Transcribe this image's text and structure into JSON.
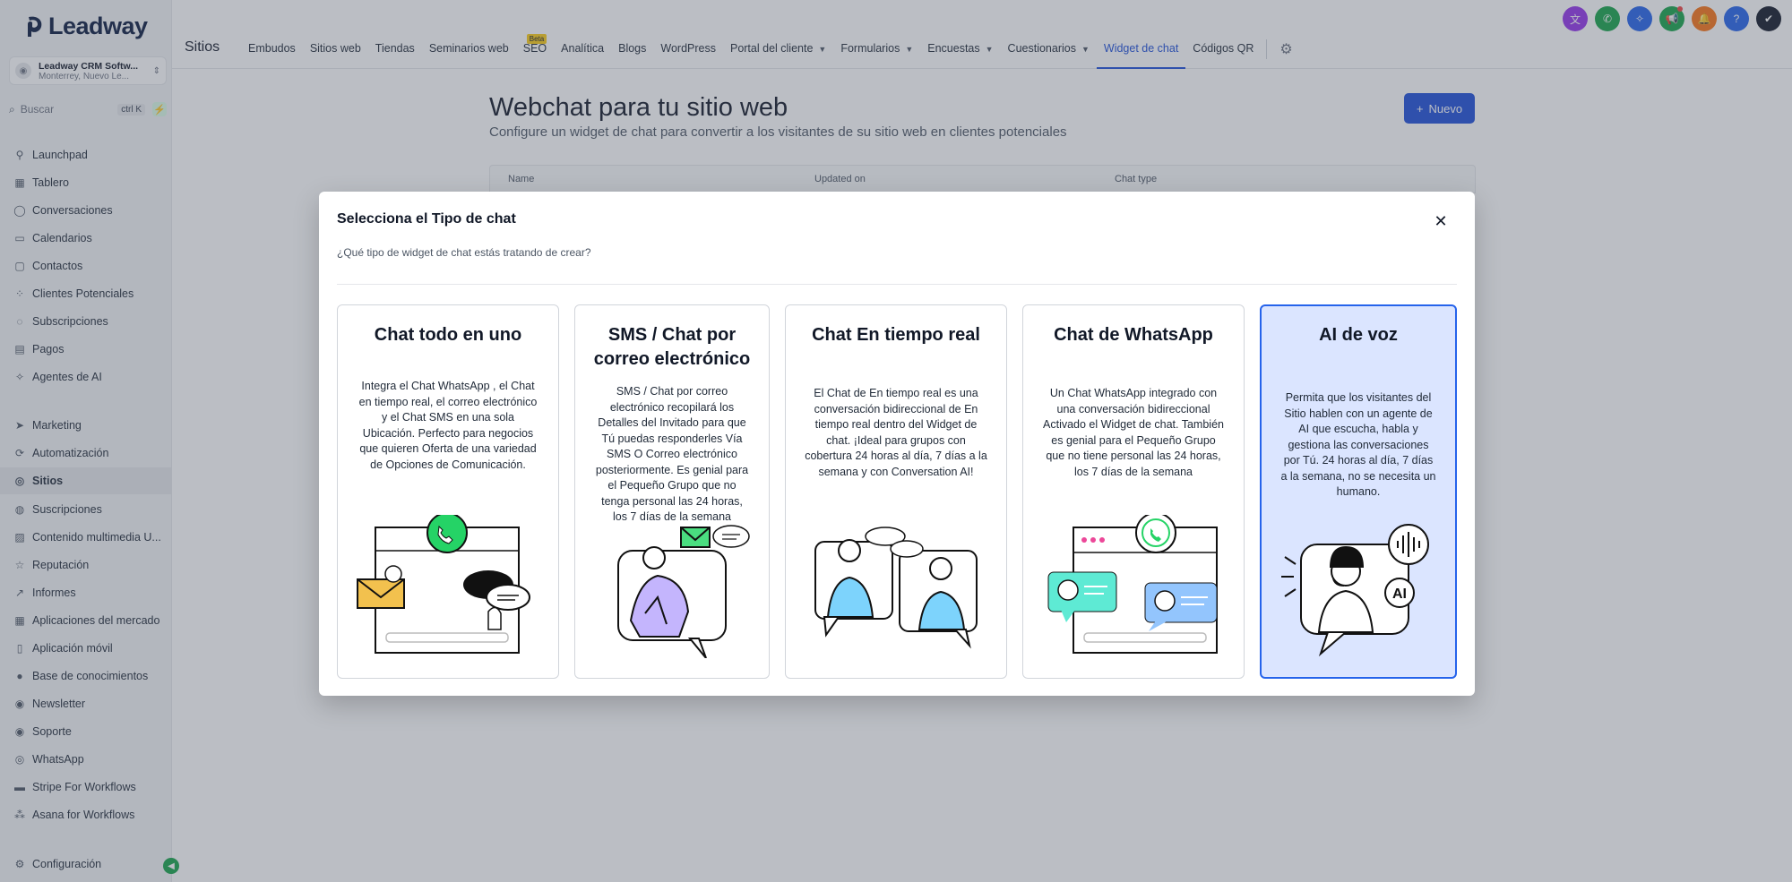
{
  "app": {
    "brand": "Leadway"
  },
  "location": {
    "name": "Leadway CRM Softw...",
    "sub": "Monterrey, Nuevo Le..."
  },
  "search": {
    "label": "Buscar",
    "shortcut": "ctrl K"
  },
  "sidebar": {
    "items": [
      {
        "label": "Launchpad",
        "icon": "rocket-icon",
        "glyph": "⚲"
      },
      {
        "label": "Tablero",
        "icon": "dashboard-icon",
        "glyph": "▦"
      },
      {
        "label": "Conversaciones",
        "icon": "chat-icon",
        "glyph": "◯"
      },
      {
        "label": "Calendarios",
        "icon": "calendar-icon",
        "glyph": "▭"
      },
      {
        "label": "Contactos",
        "icon": "contacts-icon",
        "glyph": "▢"
      },
      {
        "label": "Clientes Potenciales",
        "icon": "opportunities-icon",
        "glyph": "⁘"
      },
      {
        "label": "Subscripciones",
        "icon": "subscriptions-icon",
        "glyph": "◌"
      },
      {
        "label": "Pagos",
        "icon": "payments-icon",
        "glyph": "▤"
      },
      {
        "label": "Agentes de AI",
        "icon": "ai-agents-icon",
        "glyph": "✧"
      },
      {
        "label": "Marketing",
        "icon": "marketing-icon",
        "glyph": "➤"
      },
      {
        "label": "Automatización",
        "icon": "automation-icon",
        "glyph": "⟳"
      },
      {
        "label": "Sitios",
        "icon": "sites-icon",
        "glyph": "◎"
      },
      {
        "label": "Suscripciones",
        "icon": "memberships-icon",
        "glyph": "◍"
      },
      {
        "label": "Contenido multimedia U...",
        "icon": "media-icon",
        "glyph": "▨"
      },
      {
        "label": "Reputación",
        "icon": "star-icon",
        "glyph": "☆"
      },
      {
        "label": "Informes",
        "icon": "reports-icon",
        "glyph": "↗"
      },
      {
        "label": "Aplicaciones del mercado",
        "icon": "apps-icon",
        "glyph": "▦"
      },
      {
        "label": "Aplicación móvil",
        "icon": "mobile-icon",
        "glyph": "▯"
      },
      {
        "label": "Base de conocimientos",
        "icon": "info-icon",
        "glyph": "●"
      },
      {
        "label": "Newsletter",
        "icon": "newsletter-icon",
        "glyph": "◉"
      },
      {
        "label": "Soporte",
        "icon": "support-icon",
        "glyph": "◉"
      },
      {
        "label": "WhatsApp",
        "icon": "whatsapp-icon",
        "glyph": "◎"
      },
      {
        "label": "Stripe For Workflows",
        "icon": "stripe-icon",
        "glyph": "▬"
      },
      {
        "label": "Asana for Workflows",
        "icon": "asana-icon",
        "glyph": "⁂"
      },
      {
        "label": "Configuración",
        "icon": "settings-icon",
        "glyph": "⚙"
      }
    ],
    "active_index": 11
  },
  "topnav": {
    "section_title": "Sitios",
    "tabs": [
      {
        "label": "Embudos"
      },
      {
        "label": "Sitios web"
      },
      {
        "label": "Tiendas"
      },
      {
        "label": "Seminarios web"
      },
      {
        "label": "SEO",
        "badge": "Beta"
      },
      {
        "label": "Analítica"
      },
      {
        "label": "Blogs"
      },
      {
        "label": "WordPress"
      },
      {
        "label": "Portal del cliente",
        "dropdown": true
      },
      {
        "label": "Formularios",
        "dropdown": true
      },
      {
        "label": "Encuestas",
        "dropdown": true
      },
      {
        "label": "Cuestionarios",
        "dropdown": true
      },
      {
        "label": "Widget de chat",
        "active": true
      },
      {
        "label": "Códigos QR"
      }
    ],
    "right_icons": [
      {
        "name": "translate-icon",
        "color": "#9333ea",
        "glyph": "文"
      },
      {
        "name": "phone-icon",
        "color": "#16a34a",
        "glyph": "✆"
      },
      {
        "name": "magic-icon",
        "color": "#2563eb",
        "glyph": "✧"
      },
      {
        "name": "megaphone-icon",
        "color": "#16a34a",
        "glyph": "📢"
      },
      {
        "name": "notifications-icon",
        "color": "#f97316",
        "glyph": "🔔"
      },
      {
        "name": "help-icon",
        "color": "#2563eb",
        "glyph": "?"
      },
      {
        "name": "profile-icon",
        "color": "#111827",
        "glyph": "✔"
      }
    ]
  },
  "page": {
    "title": "Webchat para tu sitio web",
    "subtitle": "Configure un widget de chat para convertir a los visitantes de su sitio web en clientes potenciales",
    "new_button": "Nuevo",
    "columns": [
      "Name",
      "Updated on",
      "Chat type"
    ]
  },
  "modal": {
    "title": "Selecciona el Tipo de chat",
    "subtitle": "¿Qué tipo de widget de chat estás tratando de crear?",
    "selected_index": 4,
    "cards": [
      {
        "title": "Chat todo en uno",
        "description": "Integra el Chat WhatsApp , el Chat en tiempo real, el correo electrónico y el Chat SMS en una sola Ubicación. Perfecto para negocios que quieren Oferta de una variedad de Opciones de Comunicación.",
        "illustration": "all-in-one-illustration"
      },
      {
        "title": "SMS / Chat por correo electrónico",
        "description": "SMS / Chat por correo electrónico recopilará los Detalles del Invitado para que Tú puedas responderles Vía SMS O Correo electrónico posteriormente. Es genial para el Pequeño Grupo que no tenga personal las 24 horas, los 7 días de la semana",
        "illustration": "sms-email-illustration"
      },
      {
        "title": "Chat En tiempo real",
        "description": "El Chat de En tiempo real es una conversación bidireccional de En tiempo real dentro del Widget de chat. ¡Ideal para grupos con cobertura 24 horas al día, 7 días a la semana y con Conversation AI!",
        "illustration": "live-chat-illustration"
      },
      {
        "title": "Chat de WhatsApp",
        "description": "Un Chat WhatsApp integrado con una conversación bidireccional Activado el Widget de chat. También es genial para el Pequeño Grupo que no tiene personal las 24 horas, los 7 días de la semana",
        "illustration": "whatsapp-illustration"
      },
      {
        "title": "AI de voz",
        "description": "Permita que los visitantes del Sitio hablen con un agente de AI que escucha, habla y gestiona las conversaciones por Tú. 24 horas al día, 7 días a la semana, no se necesita un humano.",
        "illustration": "voice-ai-illustration"
      }
    ]
  },
  "colors": {
    "accent": "#1d4ed8",
    "selected_card_bg": "#dbe5ff",
    "whatsapp_green": "#25d366"
  }
}
